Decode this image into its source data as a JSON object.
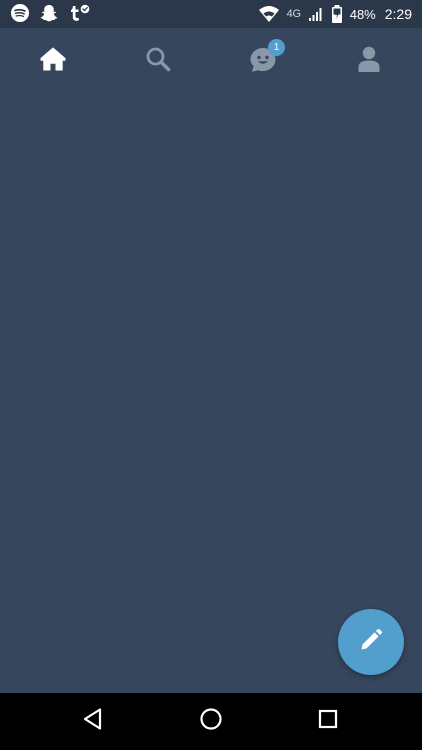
{
  "status_bar": {
    "left_icons": [
      "spotify-icon",
      "snapchat-icon",
      "tumblr-check-icon"
    ],
    "network_type": "4G",
    "battery_percent": "48%",
    "time": "2:29"
  },
  "top_nav": {
    "tabs": [
      {
        "name": "home",
        "icon": "home-icon",
        "active": true
      },
      {
        "name": "search",
        "icon": "search-icon",
        "active": false
      },
      {
        "name": "activity",
        "icon": "face-icon",
        "active": false,
        "badge": "1"
      },
      {
        "name": "account",
        "icon": "person-icon",
        "active": false
      }
    ]
  },
  "fab": {
    "icon": "pencil-icon"
  },
  "system_nav": {
    "buttons": [
      "back-triangle-icon",
      "home-circle-icon",
      "recents-square-icon"
    ]
  },
  "colors": {
    "background": "#36465d",
    "status_bar": "#2b384a",
    "accent": "#529ecc",
    "inactive_icon": "#8a97a8",
    "active_icon": "#ffffff"
  }
}
